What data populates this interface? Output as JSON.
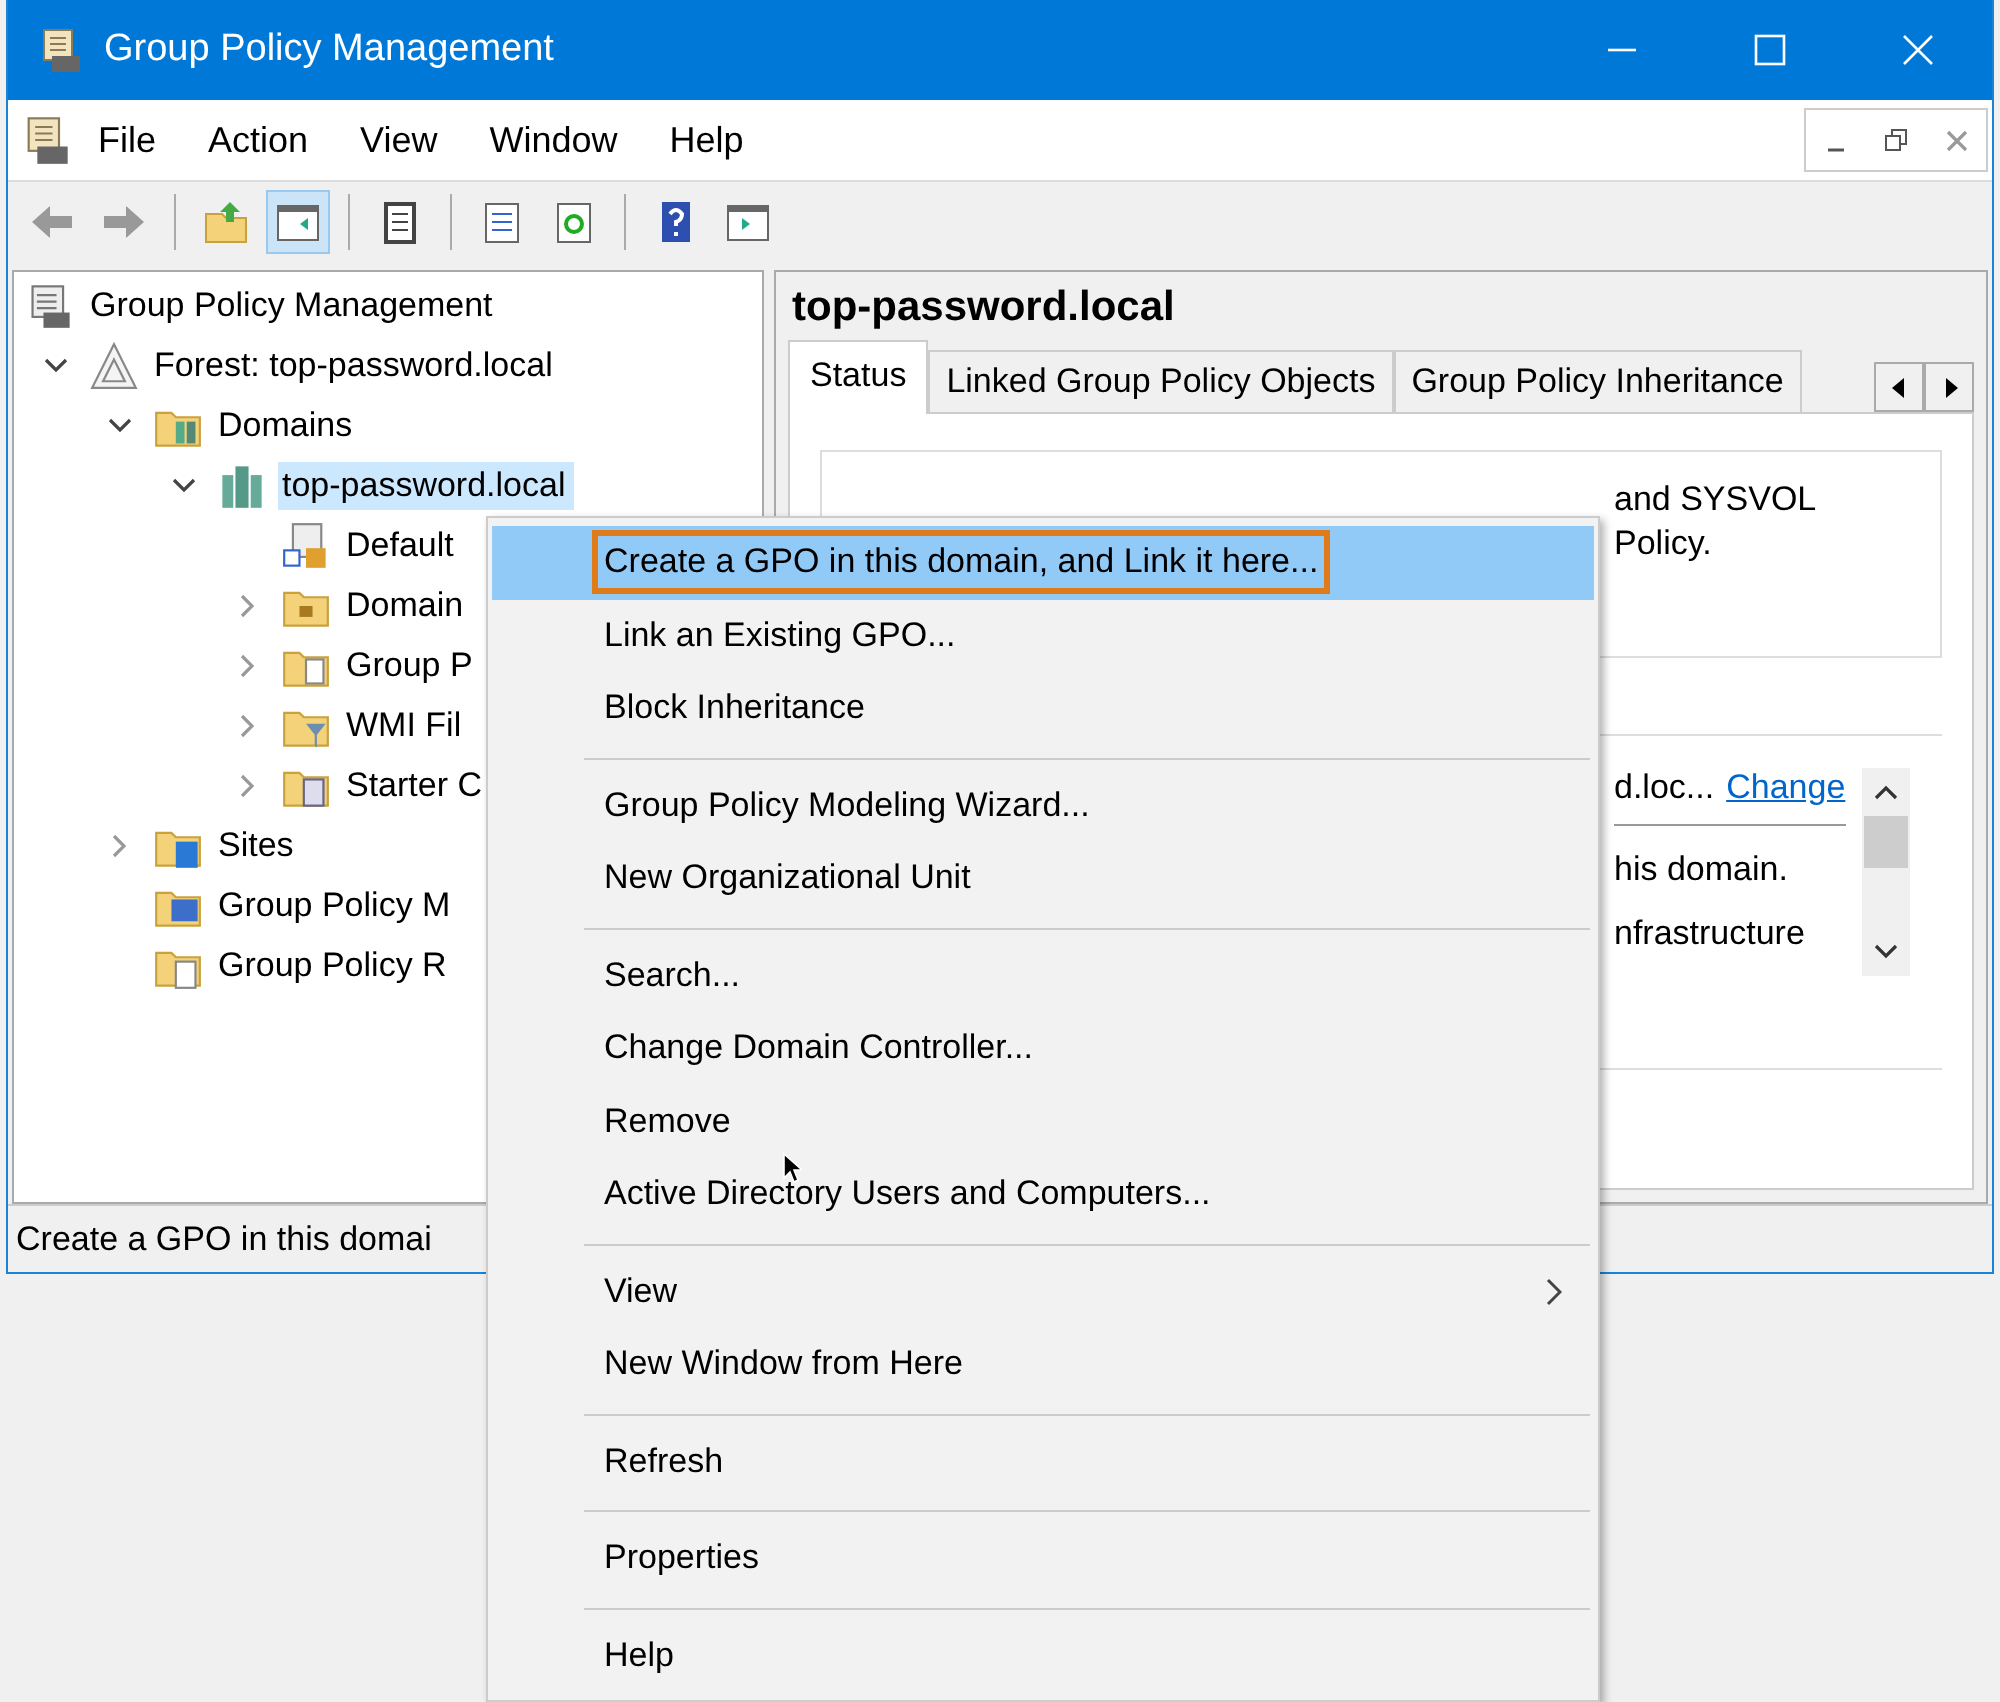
{
  "window": {
    "title": "Group Policy Management"
  },
  "menu_bar": {
    "items": [
      "File",
      "Action",
      "View",
      "Window",
      "Help"
    ]
  },
  "toolbar": {
    "buttons": [
      {
        "kind": "back",
        "selected": false
      },
      {
        "kind": "forward",
        "selected": false
      },
      {
        "kind": "separator"
      },
      {
        "kind": "up",
        "selected": false
      },
      {
        "kind": "tree",
        "selected": true
      },
      {
        "kind": "separator"
      },
      {
        "kind": "clipboard",
        "selected": false
      },
      {
        "kind": "separator"
      },
      {
        "kind": "export",
        "selected": false
      },
      {
        "kind": "refresh",
        "selected": false
      },
      {
        "kind": "separator"
      },
      {
        "kind": "help",
        "selected": false
      },
      {
        "kind": "pane",
        "selected": false
      }
    ]
  },
  "tree": [
    {
      "label": "Group Policy Management",
      "kind": "console",
      "selected": false,
      "children": [
        {
          "label": "Forest: top-password.local",
          "kind": "forest",
          "expanded": true,
          "selected": false,
          "children": [
            {
              "label": "Domains",
              "kind": "domains",
              "expanded": true,
              "selected": false,
              "children": [
                {
                  "label": "top-password.local",
                  "kind": "domain",
                  "expanded": true,
                  "selected": true,
                  "children": [
                    {
                      "label": "Default",
                      "kind": "gpo-link",
                      "selected": false
                    },
                    {
                      "label": "Domain",
                      "kind": "folder",
                      "expanded": false,
                      "selected": false
                    },
                    {
                      "label": "Group P",
                      "kind": "gpo-folder",
                      "expanded": false,
                      "selected": false
                    },
                    {
                      "label": "WMI Fil",
                      "kind": "filter-folder",
                      "expanded": false,
                      "selected": false
                    },
                    {
                      "label": "Starter C",
                      "kind": "starter-folder",
                      "expanded": false,
                      "selected": false
                    }
                  ]
                }
              ]
            },
            {
              "label": "Sites",
              "kind": "sites",
              "expanded": false,
              "selected": false
            },
            {
              "label": "Group Policy M",
              "kind": "modeling",
              "selected": false
            },
            {
              "label": "Group Policy R",
              "kind": "results",
              "selected": false
            }
          ]
        }
      ]
    }
  ],
  "details": {
    "title": "top-password.local",
    "tabs": [
      {
        "label": "Status",
        "selected": true
      },
      {
        "label": "Linked Group Policy Objects",
        "selected": false
      },
      {
        "label": "Group Policy Inheritance",
        "selected": false
      }
    ],
    "panel_1": {
      "lines": [
        "and SYSVOL",
        "Policy."
      ]
    },
    "panel_2": {
      "text": "d.loc...",
      "link": "Change",
      "lines": [
        "his domain.",
        "nfrastructure"
      ]
    }
  },
  "status_bar": {
    "text": "Create a GPO in this domai"
  },
  "context_menu": {
    "items": [
      {
        "kind": "item",
        "label": "Create a GPO in this domain, and Link it here...",
        "selected": true,
        "outlined": true,
        "submenu": false
      },
      {
        "kind": "item",
        "label": "Link an Existing GPO...",
        "selected": false,
        "submenu": false
      },
      {
        "kind": "item",
        "label": "Block Inheritance",
        "selected": false,
        "submenu": false
      },
      {
        "kind": "separator"
      },
      {
        "kind": "item",
        "label": "Group Policy Modeling Wizard...",
        "selected": false,
        "submenu": false
      },
      {
        "kind": "item",
        "label": "New Organizational Unit",
        "selected": false,
        "submenu": false
      },
      {
        "kind": "separator"
      },
      {
        "kind": "item",
        "label": "Search...",
        "selected": false,
        "submenu": false
      },
      {
        "kind": "item",
        "label": "Change Domain Controller...",
        "selected": false,
        "submenu": false
      },
      {
        "kind": "item",
        "label": "Remove",
        "selected": false,
        "submenu": false
      },
      {
        "kind": "item",
        "label": "Active Directory Users and Computers...",
        "selected": false,
        "submenu": false
      },
      {
        "kind": "separator"
      },
      {
        "kind": "item",
        "label": "View",
        "selected": false,
        "submenu": true
      },
      {
        "kind": "item",
        "label": "New Window from Here",
        "selected": false,
        "submenu": false
      },
      {
        "kind": "separator"
      },
      {
        "kind": "item",
        "label": "Refresh",
        "selected": false,
        "submenu": false
      },
      {
        "kind": "separator"
      },
      {
        "kind": "item",
        "label": "Properties",
        "selected": false,
        "submenu": false
      },
      {
        "kind": "separator"
      },
      {
        "kind": "item",
        "label": "Help",
        "selected": false,
        "submenu": false
      }
    ]
  }
}
